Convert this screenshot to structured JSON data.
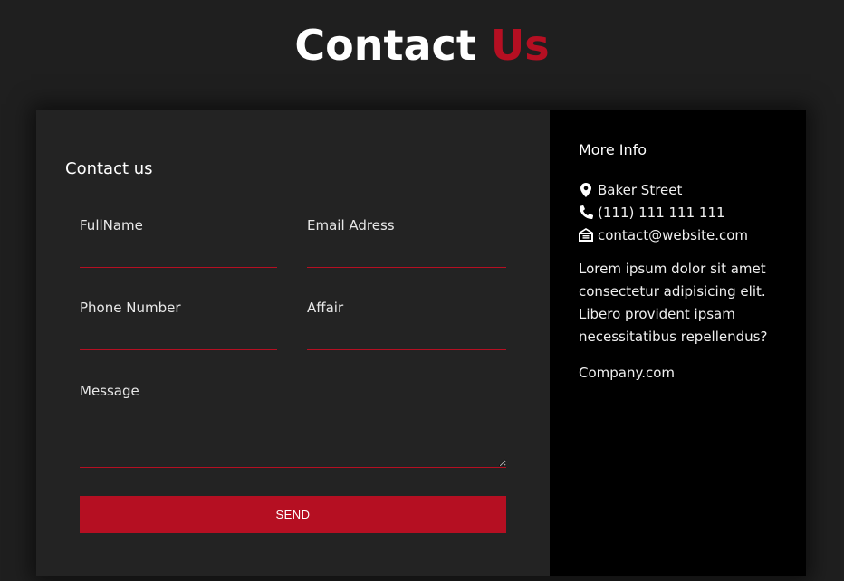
{
  "header": {
    "title_main": "Contact",
    "title_accent": "Us"
  },
  "form": {
    "heading": "Contact us",
    "fields": [
      {
        "label": "FullName",
        "value": ""
      },
      {
        "label": "Email Adress",
        "value": ""
      },
      {
        "label": "Phone Number",
        "value": ""
      },
      {
        "label": "Affair",
        "value": ""
      },
      {
        "label": "Message",
        "value": ""
      }
    ],
    "send_label": "SEND"
  },
  "info": {
    "heading": "More Info",
    "items": [
      {
        "icon": "map-marker-icon",
        "text": "Baker Street"
      },
      {
        "icon": "phone-icon",
        "text": "(111) 111 111 111"
      },
      {
        "icon": "envelope-open-icon",
        "text": "contact@website.com"
      }
    ],
    "description": "Lorem ipsum dolor sit amet consectetur adipisicing elit. Libero provident ipsam necessitatibus repellendus?",
    "footer": "Company.com"
  },
  "colors": {
    "background": "#1f1f1f",
    "card": "#232323",
    "info_panel": "#000000",
    "accent": "#b50f22",
    "text": "#ffffff"
  }
}
